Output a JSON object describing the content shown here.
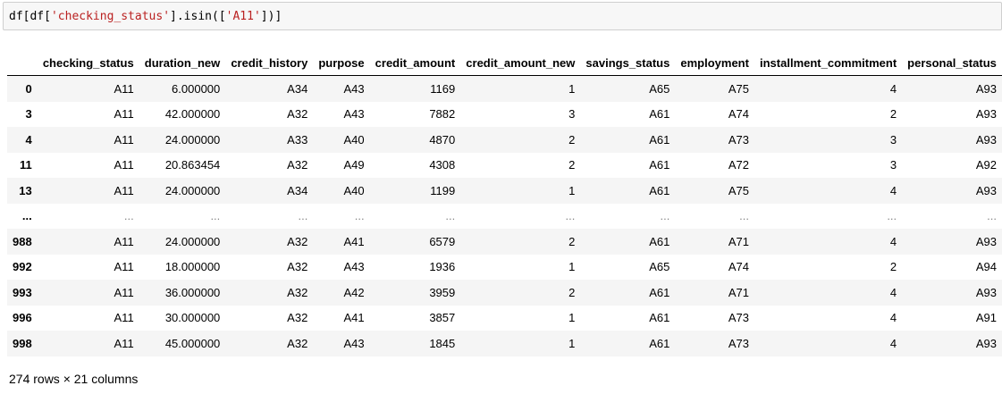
{
  "input": {
    "code_prefix": "df[df[",
    "code_key": "'checking_status'",
    "code_mid": "].isin([",
    "code_val": "'A11'",
    "code_suffix": "])]"
  },
  "table": {
    "columns": [
      "",
      "checking_status",
      "duration_new",
      "credit_history",
      "purpose",
      "credit_amount",
      "credit_amount_new",
      "savings_status",
      "employment",
      "installment_commitment",
      "personal_status"
    ],
    "rows": [
      {
        "index": "0",
        "cells": [
          "A11",
          "6.000000",
          "A34",
          "A43",
          "1169",
          "1",
          "A65",
          "A75",
          "4",
          "A93"
        ]
      },
      {
        "index": "3",
        "cells": [
          "A11",
          "42.000000",
          "A32",
          "A43",
          "7882",
          "3",
          "A61",
          "A74",
          "2",
          "A93"
        ]
      },
      {
        "index": "4",
        "cells": [
          "A11",
          "24.000000",
          "A33",
          "A40",
          "4870",
          "2",
          "A61",
          "A73",
          "3",
          "A93"
        ]
      },
      {
        "index": "11",
        "cells": [
          "A11",
          "20.863454",
          "A32",
          "A49",
          "4308",
          "2",
          "A61",
          "A72",
          "3",
          "A92"
        ]
      },
      {
        "index": "13",
        "cells": [
          "A11",
          "24.000000",
          "A34",
          "A40",
          "1199",
          "1",
          "A61",
          "A75",
          "4",
          "A93"
        ]
      },
      {
        "index": "...",
        "cells": [
          "...",
          "...",
          "...",
          "...",
          "...",
          "...",
          "...",
          "...",
          "...",
          "..."
        ]
      },
      {
        "index": "988",
        "cells": [
          "A11",
          "24.000000",
          "A32",
          "A41",
          "6579",
          "2",
          "A61",
          "A71",
          "4",
          "A93"
        ]
      },
      {
        "index": "992",
        "cells": [
          "A11",
          "18.000000",
          "A32",
          "A43",
          "1936",
          "1",
          "A65",
          "A74",
          "2",
          "A94"
        ]
      },
      {
        "index": "993",
        "cells": [
          "A11",
          "36.000000",
          "A32",
          "A42",
          "3959",
          "2",
          "A61",
          "A71",
          "4",
          "A93"
        ]
      },
      {
        "index": "996",
        "cells": [
          "A11",
          "30.000000",
          "A32",
          "A41",
          "3857",
          "1",
          "A61",
          "A73",
          "4",
          "A91"
        ]
      },
      {
        "index": "998",
        "cells": [
          "A11",
          "45.000000",
          "A32",
          "A43",
          "1845",
          "1",
          "A61",
          "A73",
          "4",
          "A93"
        ]
      }
    ]
  },
  "footer": {
    "shape": "274 rows × 21 columns"
  }
}
